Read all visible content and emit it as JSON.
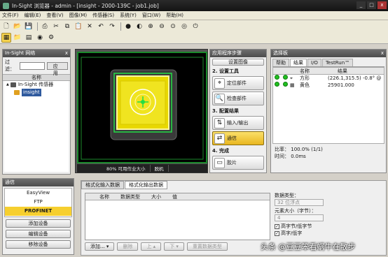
{
  "window": {
    "title": "In-Sight 浏览器 - admin - [insight - 2000-139C - job1.job]",
    "controls": [
      "_",
      "□",
      "x"
    ]
  },
  "menu": [
    "文件(F)",
    "编辑(E)",
    "查看(V)",
    "图像(M)",
    "传感器(S)",
    "系统(Y)",
    "窗口(W)",
    "帮助(H)"
  ],
  "network": {
    "header": "In-Sight 网络",
    "close": "x",
    "filter_label": "过滤：",
    "apply_button": "应用",
    "column": "名称",
    "tree": [
      {
        "label": "In-Sight 传感器",
        "expander": "▲"
      },
      {
        "label": "insight"
      }
    ]
  },
  "comm": {
    "header": "通信",
    "items": [
      "EasyView",
      "FTP",
      "PROFINET"
    ],
    "selected": "PROFINET",
    "buttons": [
      "添加设备",
      "编辑设备",
      "移除设备"
    ]
  },
  "image": {
    "status": [
      "80% 可用作业大小",
      "脱机"
    ]
  },
  "steps": {
    "header": "应用程序步骤",
    "partial_top": "设置图像",
    "sections": [
      {
        "title": "2. 设置工具",
        "items": [
          {
            "label": "定位部件",
            "icon": "locate-icon"
          },
          {
            "label": "检查部件",
            "icon": "inspect-icon"
          }
        ]
      },
      {
        "title": "3. 配置结果",
        "items": [
          {
            "label": "输入/输出",
            "icon": "io-icon"
          },
          {
            "label": "通信",
            "icon": "comm-icon"
          }
        ]
      },
      {
        "title": "4. 完成",
        "items": [
          {
            "label": "胶片",
            "icon": "film-icon"
          }
        ]
      }
    ],
    "selected": "通信"
  },
  "palette": {
    "header": "选择板",
    "close": "x",
    "tabs": [
      "帮助",
      "结果",
      "I/O",
      "TestRun™"
    ],
    "active_tab": "结果",
    "columns": [
      "名称",
      "结果"
    ],
    "rows": [
      {
        "name": "方形",
        "result": "(226.1,315.5) -0.8° @"
      },
      {
        "name": "黄色",
        "result": "25901.000"
      }
    ],
    "pass_color": "#20c020",
    "pass_rate_label": "比率：",
    "pass_rate": "100.0% (1/1)",
    "time_label": "时间：",
    "time": "0.0ms"
  },
  "format": {
    "tabs": [
      "格式化输入数据",
      "格式化输出数据"
    ],
    "active_tab": "格式化输出数据",
    "columns": [
      "名称",
      "数据类型",
      "大小",
      "值"
    ],
    "data_type_label": "数据类型：",
    "data_type": "32 位浮点",
    "size_label": "元素大小（字节）：",
    "size": "4",
    "checks": [
      "高字节/低字节",
      "高字/低字"
    ],
    "buttons": [
      "添加...",
      "删除",
      "上",
      "下",
      "重置数据类型"
    ],
    "button_arrows": [
      "▾",
      "",
      "▴",
      "▾",
      ""
    ]
  },
  "watermark": "头条 @豆豆笨看蜗牛在散步",
  "accent": "#f6cf2f"
}
